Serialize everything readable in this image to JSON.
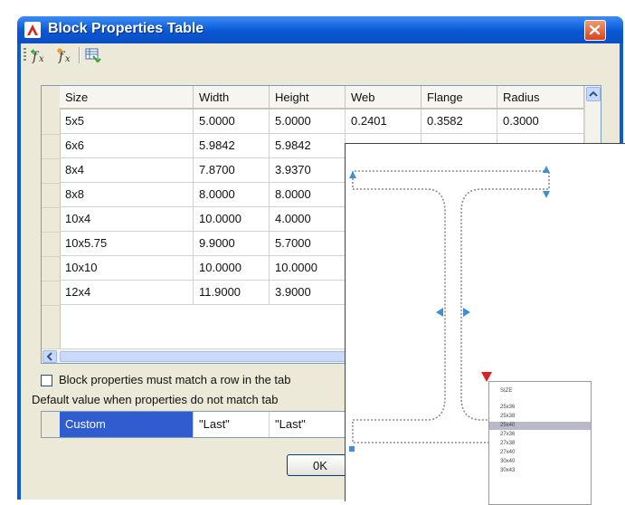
{
  "window": {
    "title": "Block Properties Table",
    "icons": {
      "app": "autocad-app-icon",
      "close": "close-icon"
    }
  },
  "toolbar": {
    "buttons": [
      {
        "name": "new-property-parameter-icon"
      },
      {
        "name": "add-user-parameter-icon"
      },
      {
        "name": "audit-table-icon"
      }
    ]
  },
  "table": {
    "columns": [
      "Size",
      "Width",
      "Height",
      "Web",
      "Flange",
      "Radius"
    ],
    "rows": [
      [
        "5x5",
        "5.0000",
        "5.0000",
        "0.2401",
        "0.3582",
        "0.3000"
      ],
      [
        "6x6",
        "5.9842",
        "5.9842",
        "",
        "",
        ""
      ],
      [
        "8x4",
        "7.8700",
        "3.9370",
        "",
        "",
        ""
      ],
      [
        "8x8",
        "8.0000",
        "8.0000",
        "",
        "",
        ""
      ],
      [
        "10x4",
        "10.0000",
        "4.0000",
        "",
        "",
        ""
      ],
      [
        "10x5.75",
        "9.9000",
        "5.7000",
        "",
        "",
        ""
      ],
      [
        "10x10",
        "10.0000",
        "10.0000",
        "",
        "",
        ""
      ],
      [
        "12x4",
        "11.9000",
        "3.9000",
        "",
        "",
        ""
      ]
    ]
  },
  "checkbox": {
    "label": "Block properties must match a row in the tab",
    "checked": false
  },
  "default_label": "Default value when properties do not match tab",
  "default_row": [
    "Custom",
    "\"Last\"",
    "\"Last\""
  ],
  "ok_label": "0K",
  "lookup_menu": {
    "items": [
      "SIZE",
      "25x36",
      "25x38",
      "25x40",
      "27x36",
      "27x38",
      "27x40",
      "30x40",
      "30x43"
    ],
    "selected": "25x40"
  },
  "colors": {
    "title": "#0a57d3",
    "selection": "#2f5ccf",
    "grip": "#3f8fd6",
    "lookup_grip": "#d6232a"
  }
}
